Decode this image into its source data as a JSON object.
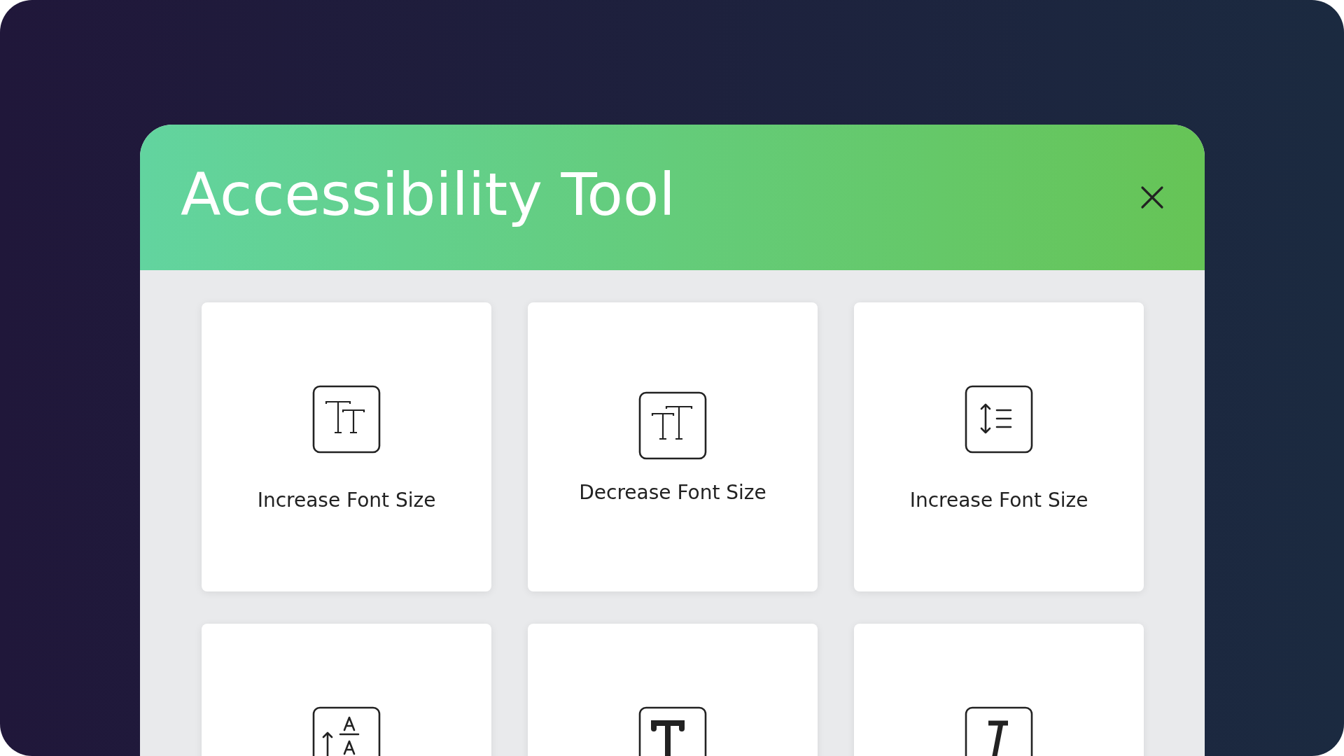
{
  "dialog": {
    "title": "Accessibility Tool"
  },
  "tools": [
    {
      "kind": "enlarge",
      "label": "Increase Font Size"
    },
    {
      "kind": "shrink",
      "label": "Decrease Font Size"
    },
    {
      "kind": "spacing",
      "label": "Increase Font Size"
    },
    {
      "kind": "scale"
    },
    {
      "kind": "bold"
    },
    {
      "kind": "italic"
    }
  ]
}
